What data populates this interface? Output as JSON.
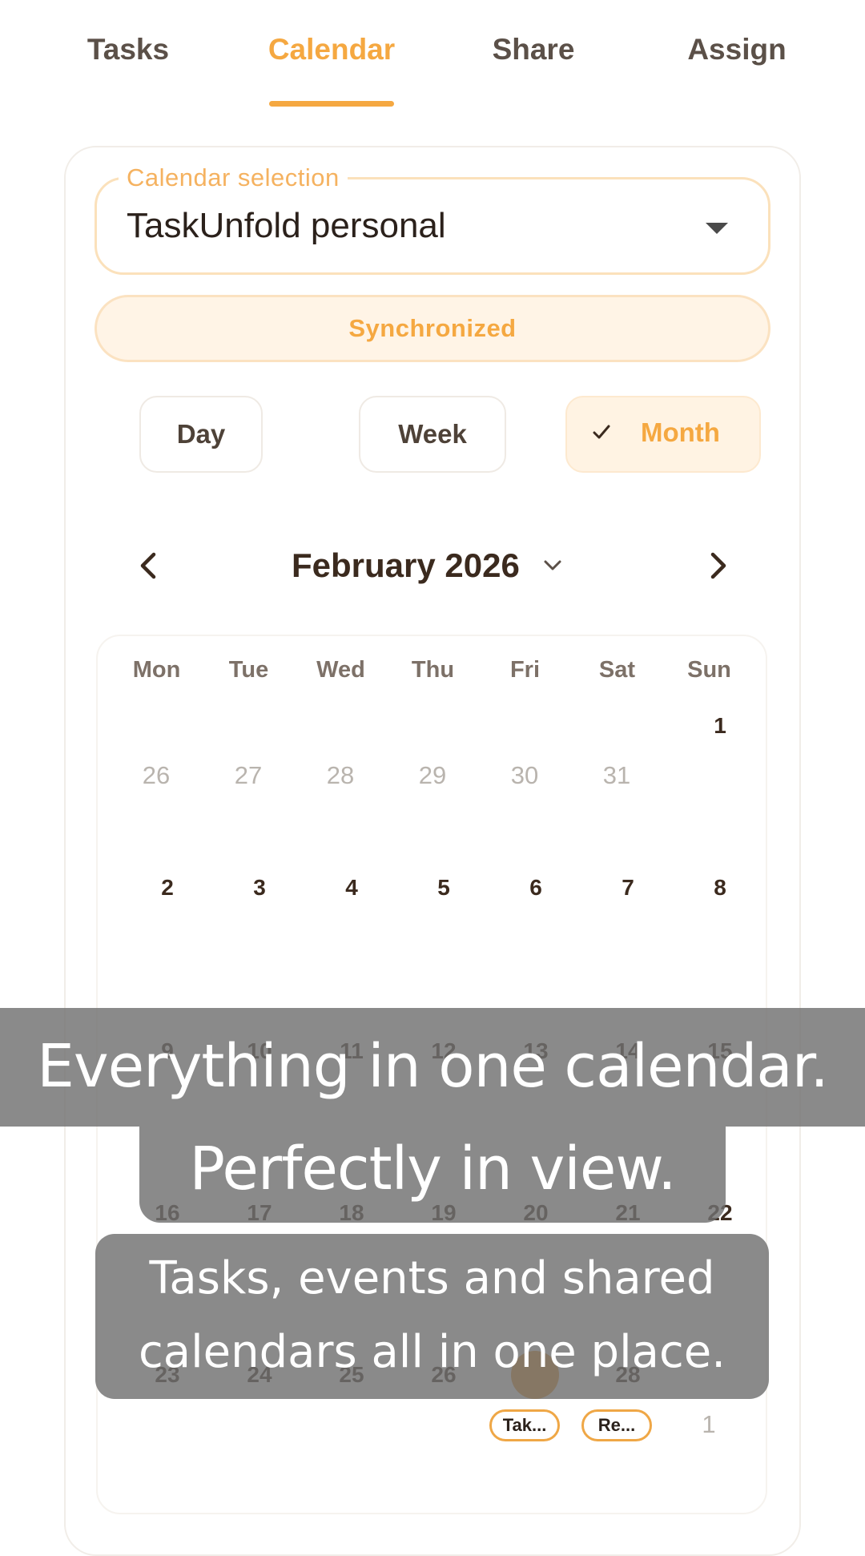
{
  "tabs": [
    {
      "label": "Tasks"
    },
    {
      "label": "Calendar"
    },
    {
      "label": "Share"
    },
    {
      "label": "Assign"
    }
  ],
  "calendar_selection": {
    "legend": "Calendar selection",
    "value": "TaskUnfold personal"
  },
  "sync_status": "Synchronized",
  "view_modes": {
    "day": "Day",
    "week": "Week",
    "month": "Month",
    "selected": "Month"
  },
  "month_nav": {
    "title": "February 2026"
  },
  "weekdays": [
    "Mon",
    "Tue",
    "Wed",
    "Thu",
    "Fri",
    "Sat",
    "Sun"
  ],
  "weeks": [
    [
      "",
      "",
      "",
      "",
      "",
      "",
      "1"
    ],
    [
      "26",
      "27",
      "28",
      "29",
      "30",
      "31",
      ""
    ],
    [
      "2",
      "3",
      "4",
      "5",
      "6",
      "7",
      "8"
    ],
    [
      "9",
      "10",
      "11",
      "12",
      "13",
      "14",
      "15"
    ],
    [
      "16",
      "17",
      "18",
      "19",
      "20",
      "21",
      "22"
    ],
    [
      "23",
      "24",
      "25",
      "26",
      "27",
      "28",
      ""
    ],
    [
      "",
      "",
      "",
      "",
      "",
      "",
      "1"
    ]
  ],
  "events": [
    {
      "label": "Tak..."
    },
    {
      "label": "Re..."
    }
  ],
  "captions": {
    "line1": "Everything in one calendar.",
    "line2": "Perfectly in view.",
    "sub": "Tasks, events and shared calendars all in one place."
  },
  "colors": {
    "accent": "#f5a841",
    "accent_soft": "#fff3e3",
    "text_dark": "#3b2a1e",
    "overlay": "#707070"
  }
}
